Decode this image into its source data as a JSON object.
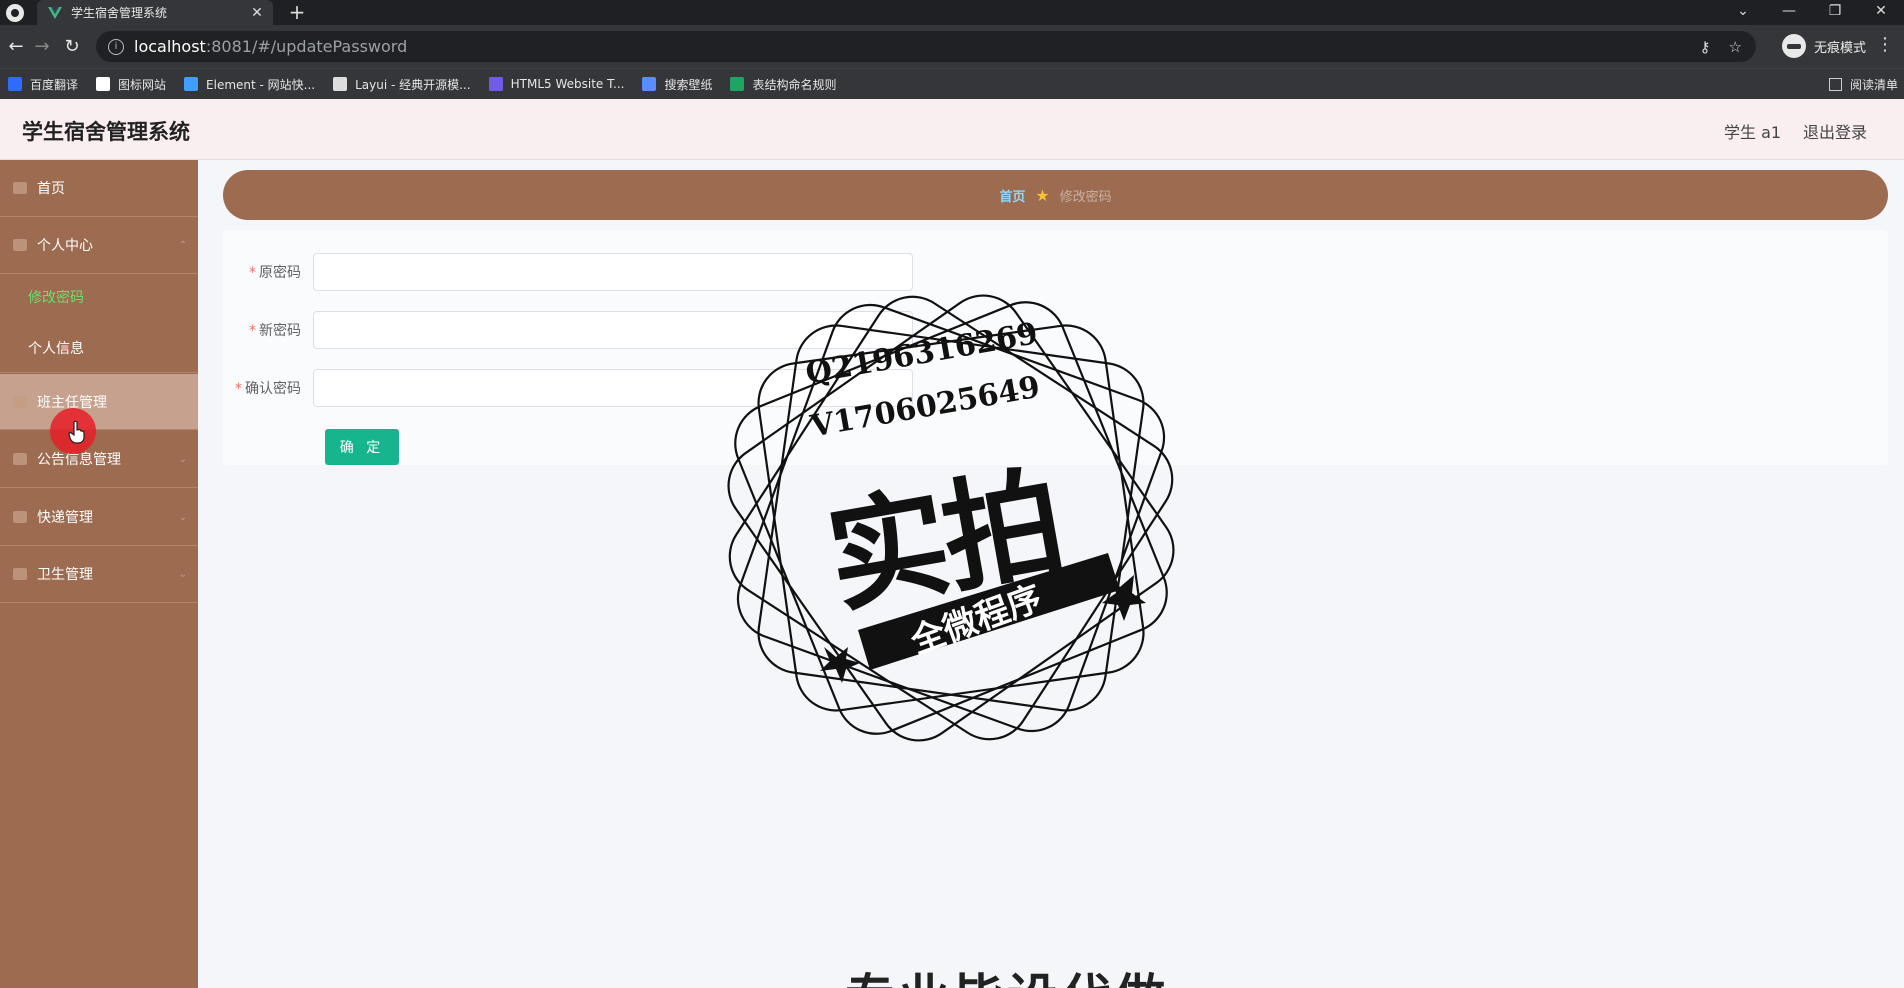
{
  "browser": {
    "tab_title": "学生宿舍管理系统",
    "tab_close": "✕",
    "new_tab": "+",
    "url_host": "localhost",
    "url_path": ":8081/#/updatePassword",
    "incognito_label": "无痕模式",
    "window_controls": [
      "⌄",
      "—",
      "❐",
      "✕"
    ],
    "bookmarks": [
      {
        "label": "百度翻译",
        "color": "#2f6bff"
      },
      {
        "label": "图标网站",
        "color": "#ffffff"
      },
      {
        "label": "Element - 网站快...",
        "color": "#409eff"
      },
      {
        "label": "Layui - 经典开源模...",
        "color": "#dddddd"
      },
      {
        "label": "HTML5 Website T...",
        "color": "#6e5ce6"
      },
      {
        "label": "搜索壁纸",
        "color": "#5b8cff"
      },
      {
        "label": "表结构命名规则",
        "color": "#1fa463"
      }
    ],
    "reading_list": "阅读清单"
  },
  "header": {
    "title": "学生宿舍管理系统",
    "user": "学生 a1",
    "logout": "退出登录"
  },
  "sidebar": {
    "items": [
      {
        "label": "首页"
      },
      {
        "label": "个人中心"
      },
      {
        "label": "班主任管理"
      },
      {
        "label": "公告信息管理"
      },
      {
        "label": "快递管理"
      },
      {
        "label": "卫生管理"
      }
    ],
    "sub_items": [
      {
        "label": "修改密码"
      },
      {
        "label": "个人信息"
      }
    ]
  },
  "breadcrumb": {
    "home": "首页",
    "current": "修改密码"
  },
  "form": {
    "old_password_label": "原密码",
    "new_password_label": "新密码",
    "confirm_password_label": "确认密码",
    "required_mark": "*",
    "old_password_value": "",
    "new_password_value": "",
    "confirm_password_value": "",
    "submit": "确 定"
  },
  "watermark": {
    "qq": "Q2196316269",
    "wechat": "V1706025649",
    "main_text": "实拍",
    "ribbon_text": "全微程序",
    "bottom_text": "专业毕设代做"
  },
  "colors": {
    "sidebar": "#9c6b50",
    "breadcrumb_bar": "#9c6b50",
    "active_submenu": "#6ddf6d",
    "primary_button": "#17b58e",
    "header_bg": "#f9eef0"
  }
}
